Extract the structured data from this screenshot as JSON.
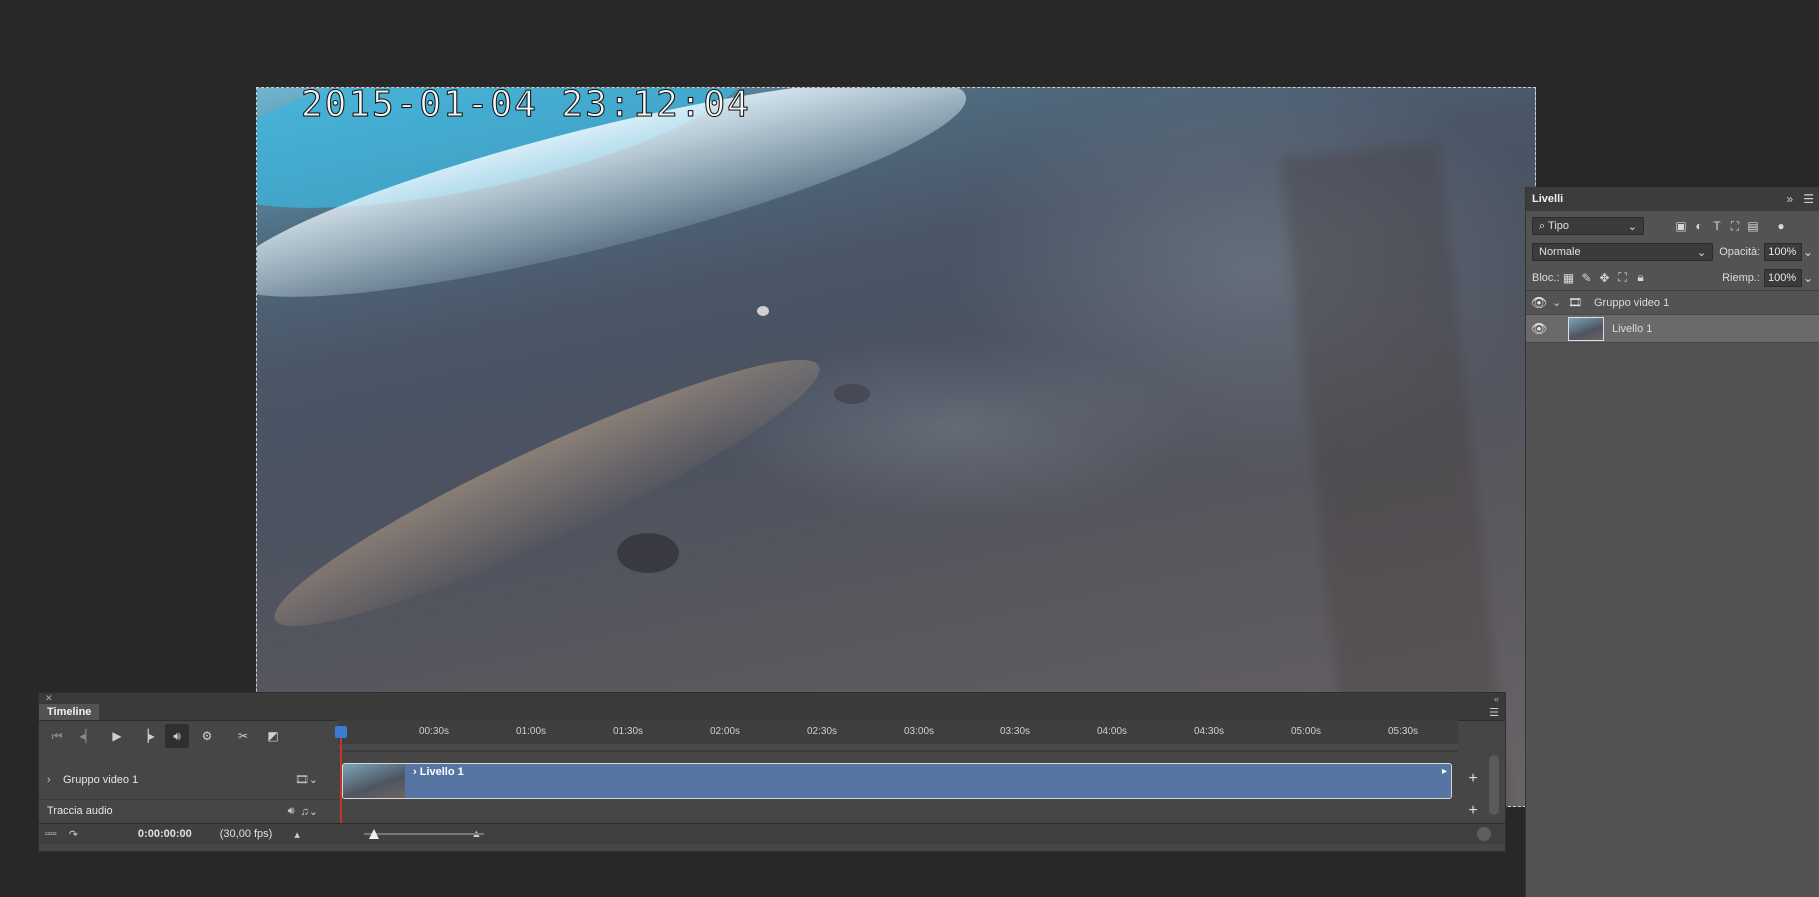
{
  "canvas": {
    "timestamp": "2015-01-04 23:12:04"
  },
  "layers_panel": {
    "tab_label": "Livelli",
    "filter_label": "Tipo",
    "blend_mode": "Normale",
    "opacity_label": "Opacità:",
    "opacity_value": "100%",
    "lock_label": "Bloc.:",
    "fill_label": "Riemp.:",
    "fill_value": "100%",
    "layers": [
      {
        "name": "Gruppo video 1",
        "type": "group"
      },
      {
        "name": "Livello 1",
        "type": "video-layer"
      }
    ]
  },
  "timeline": {
    "tab_label": "Timeline",
    "ruler_ticks": [
      "00:30s",
      "01:00s",
      "01:30s",
      "02:00s",
      "02:30s",
      "03:00s",
      "03:30s",
      "04:00s",
      "04:30s",
      "05:00s",
      "05:30s"
    ],
    "tracks": [
      {
        "label": "Gruppo video 1",
        "clip_label": "Livello 1"
      },
      {
        "label": "Traccia audio"
      }
    ],
    "current_time": "0:00:00:00",
    "fps": "(30,00 fps)"
  },
  "colors": {
    "clip": "#5775a3",
    "playhead": "#3a7bd5",
    "playline": "#c8342c",
    "panel_bg": "#535353"
  }
}
